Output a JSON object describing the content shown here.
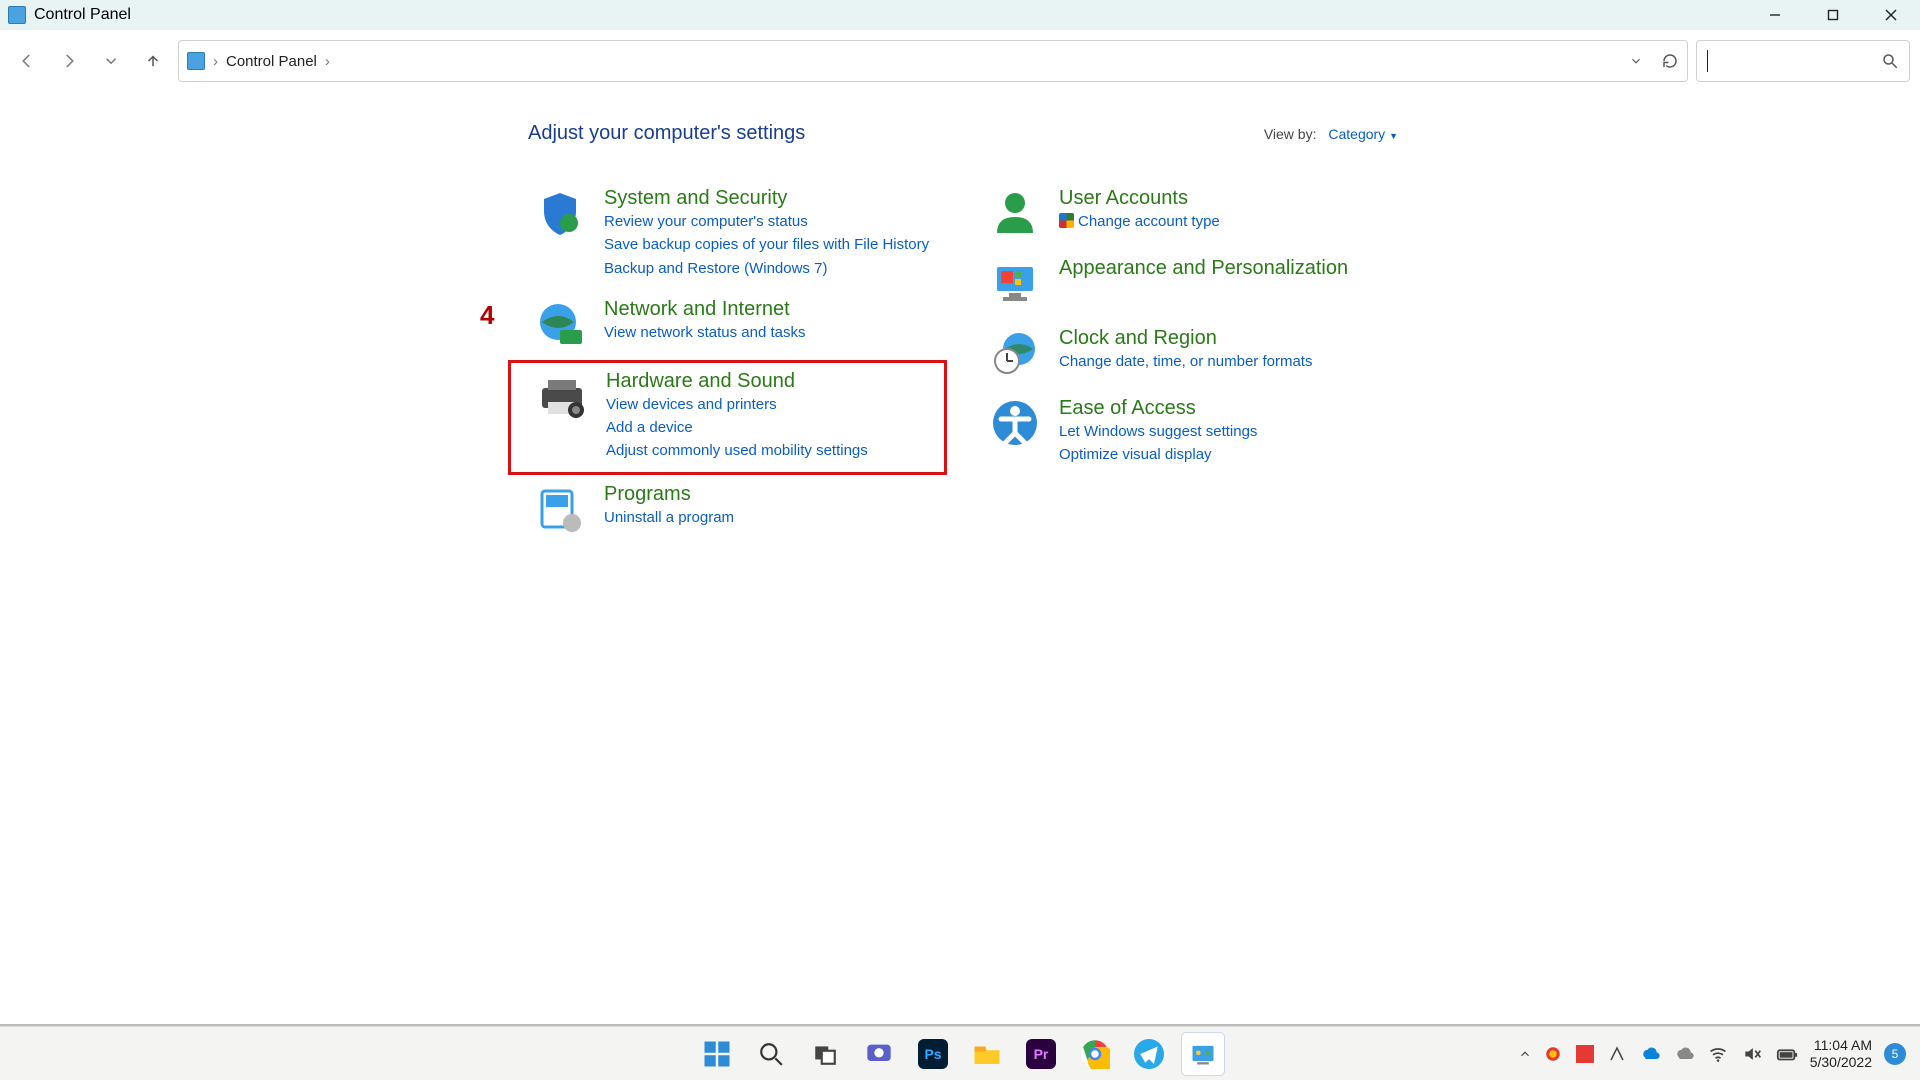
{
  "window": {
    "title": "Control Panel"
  },
  "addressbar": {
    "crumb1": "Control Panel"
  },
  "viewby": {
    "label": "View by:",
    "value": "Category"
  },
  "heading": "Adjust your computer's settings",
  "annotation_number": "4",
  "left_categories": {
    "system_security": {
      "title": "System and Security",
      "links": [
        "Review your computer's status",
        "Save backup copies of your files with File History",
        "Backup and Restore (Windows 7)"
      ]
    },
    "network": {
      "title": "Network and Internet",
      "links": [
        "View network status and tasks"
      ]
    },
    "hardware": {
      "title": "Hardware and Sound",
      "links": [
        "View devices and printers",
        "Add a device",
        "Adjust commonly used mobility settings"
      ]
    },
    "programs": {
      "title": "Programs",
      "links": [
        "Uninstall a program"
      ]
    }
  },
  "right_categories": {
    "users": {
      "title": "User Accounts",
      "links": [
        "Change account type"
      ],
      "shield": true
    },
    "appear": {
      "title": "Appearance and Personalization"
    },
    "clock": {
      "title": "Clock and Region",
      "links": [
        "Change date, time, or number formats"
      ]
    },
    "ease": {
      "title": "Ease of Access",
      "links": [
        "Let Windows suggest settings",
        "Optimize visual display"
      ]
    }
  },
  "taskbar": {
    "time": "11:04 AM",
    "date": "5/30/2022",
    "notif": "5"
  }
}
